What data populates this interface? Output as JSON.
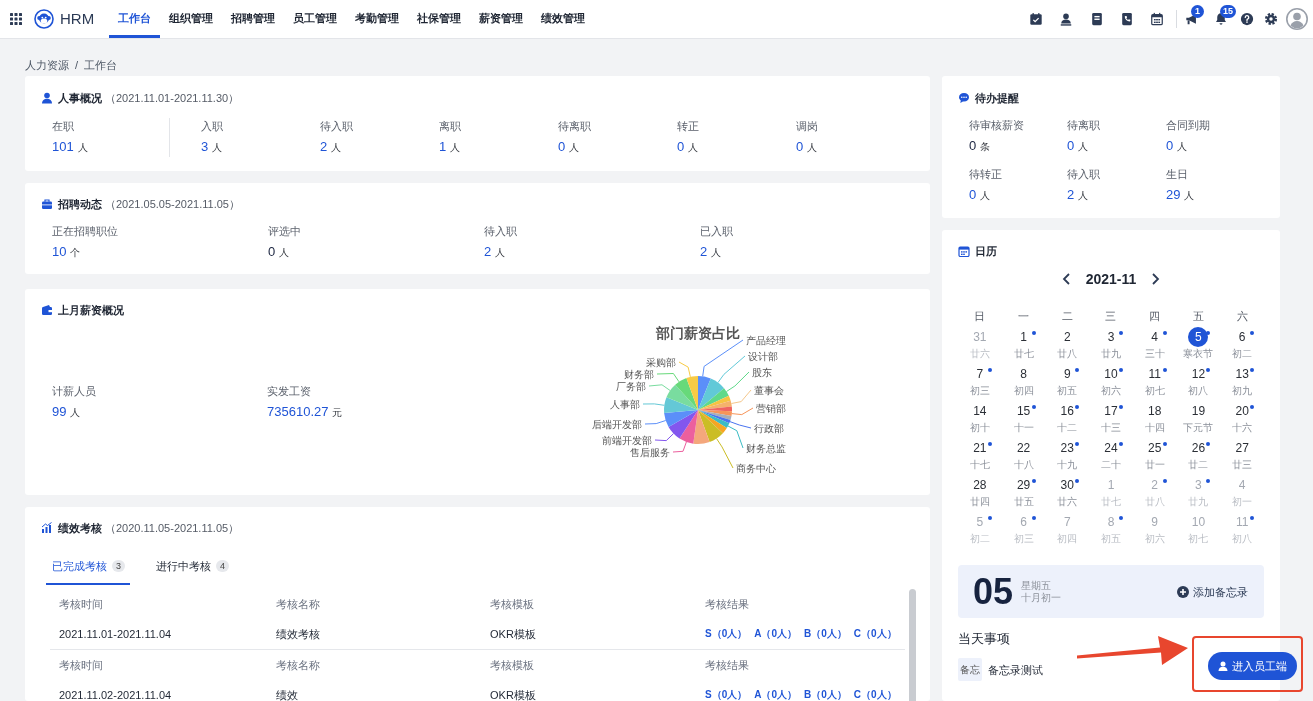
{
  "nav": {
    "brand": "HRM",
    "items": [
      {
        "label": "工作台",
        "selected": true
      },
      {
        "label": "组织管理",
        "selected": false
      },
      {
        "label": "招聘管理",
        "selected": false
      },
      {
        "label": "员工管理",
        "selected": false
      },
      {
        "label": "考勤管理",
        "selected": false
      },
      {
        "label": "社保管理",
        "selected": false
      },
      {
        "label": "薪资管理",
        "selected": false
      },
      {
        "label": "绩效管理",
        "selected": false
      }
    ],
    "flag_badge": "1",
    "bell_badge": "15"
  },
  "breadcrumb": {
    "items": [
      "人力资源",
      "工作台"
    ],
    "separator": "/"
  },
  "hr_overview": {
    "title": "人事概况",
    "range": "（2021.11.01-2021.11.30）",
    "stats": [
      {
        "label": "在职",
        "value": "101",
        "unit": "人"
      },
      {
        "label": "入职",
        "value": "3",
        "unit": "人"
      },
      {
        "label": "待入职",
        "value": "2",
        "unit": "人"
      },
      {
        "label": "离职",
        "value": "1",
        "unit": "人"
      },
      {
        "label": "待离职",
        "value": "0",
        "unit": "人"
      },
      {
        "label": "转正",
        "value": "0",
        "unit": "人"
      },
      {
        "label": "调岗",
        "value": "0",
        "unit": "人"
      }
    ]
  },
  "recruitment": {
    "title": "招聘动态",
    "range": "（2021.05.05-2021.11.05）",
    "stats": [
      {
        "label": "正在招聘职位",
        "value": "10",
        "unit": "个",
        "kind": "link"
      },
      {
        "label": "评选中",
        "value": "0",
        "unit": "人",
        "kind": "plain"
      },
      {
        "label": "待入职",
        "value": "2",
        "unit": "人",
        "kind": "link"
      },
      {
        "label": "已入职",
        "value": "2",
        "unit": "人",
        "kind": "link"
      }
    ]
  },
  "salary": {
    "title": "上月薪资概况",
    "stats": [
      {
        "label": "计薪人员",
        "value": "99",
        "unit": "人"
      },
      {
        "label": "实发工资",
        "value": "735610.27",
        "unit": "元"
      }
    ],
    "chart": {
      "title": "部门薪资占比",
      "labels": [
        "产品经理",
        "设计部",
        "采购部",
        "股东",
        "财务部",
        "厂务部",
        "董事会",
        "人事部",
        "营销部",
        "后端开发部",
        "行政部",
        "前端开发部",
        "财务总监",
        "售后服务",
        "商务中心"
      ]
    }
  },
  "performance": {
    "title": "绩效考核",
    "range": "（2020.11.05-2021.11.05）",
    "tabs": [
      {
        "label": "已完成考核",
        "count": "3",
        "selected": true
      },
      {
        "label": "进行中考核",
        "count": "4",
        "selected": false
      }
    ],
    "records": [
      {
        "headers": [
          "考核时间",
          "考核名称",
          "考核模板",
          "考核结果"
        ],
        "cells": [
          "2021.11.01-2021.11.04",
          "绩效考核",
          "OKR模板"
        ],
        "results": [
          "S（0人）",
          "A（0人）",
          "B（0人）",
          "C（0人）"
        ]
      },
      {
        "headers": [
          "考核时间",
          "考核名称",
          "考核模板",
          "考核结果"
        ],
        "cells": [
          "2021.11.02-2021.11.04",
          "绩效",
          "OKR模板"
        ],
        "results": [
          "S（0人）",
          "A（0人）",
          "B（0人）",
          "C（0人）"
        ]
      }
    ]
  },
  "todo": {
    "title": "待办提醒",
    "items": [
      {
        "label": "待审核薪资",
        "value": "0",
        "unit": "条",
        "kind": "plain"
      },
      {
        "label": "待离职",
        "value": "0",
        "unit": "人",
        "kind": "link"
      },
      {
        "label": "合同到期",
        "value": "0",
        "unit": "人",
        "kind": "link"
      },
      {
        "label": "待转正",
        "value": "0",
        "unit": "人",
        "kind": "link"
      },
      {
        "label": "待入职",
        "value": "2",
        "unit": "人",
        "kind": "link"
      },
      {
        "label": "生日",
        "value": "29",
        "unit": "人",
        "kind": "link"
      }
    ]
  },
  "calendar": {
    "title": "日历",
    "month": "2021-11",
    "weekdays": [
      "日",
      "一",
      "二",
      "三",
      "四",
      "五",
      "六"
    ],
    "weeks": [
      [
        {
          "day": "31",
          "lunar": "廿六",
          "other_month": true,
          "dot": false,
          "selected": false
        },
        {
          "day": "1",
          "lunar": "廿七",
          "other_month": false,
          "dot": true,
          "selected": false
        },
        {
          "day": "2",
          "lunar": "廿八",
          "other_month": false,
          "dot": false,
          "selected": false
        },
        {
          "day": "3",
          "lunar": "廿九",
          "other_month": false,
          "dot": true,
          "selected": false
        },
        {
          "day": "4",
          "lunar": "三十",
          "other_month": false,
          "dot": true,
          "selected": false
        },
        {
          "day": "5",
          "lunar": "寒衣节",
          "other_month": false,
          "dot": true,
          "selected": true
        },
        {
          "day": "6",
          "lunar": "初二",
          "other_month": false,
          "dot": true,
          "selected": false
        }
      ],
      [
        {
          "day": "7",
          "lunar": "初三",
          "other_month": false,
          "dot": true,
          "selected": false
        },
        {
          "day": "8",
          "lunar": "初四",
          "other_month": false,
          "dot": false,
          "selected": false
        },
        {
          "day": "9",
          "lunar": "初五",
          "other_month": false,
          "dot": true,
          "selected": false
        },
        {
          "day": "10",
          "lunar": "初六",
          "other_month": false,
          "dot": true,
          "selected": false
        },
        {
          "day": "11",
          "lunar": "初七",
          "other_month": false,
          "dot": true,
          "selected": false
        },
        {
          "day": "12",
          "lunar": "初八",
          "other_month": false,
          "dot": true,
          "selected": false
        },
        {
          "day": "13",
          "lunar": "初九",
          "other_month": false,
          "dot": true,
          "selected": false
        }
      ],
      [
        {
          "day": "14",
          "lunar": "初十",
          "other_month": false,
          "dot": false,
          "selected": false
        },
        {
          "day": "15",
          "lunar": "十一",
          "other_month": false,
          "dot": true,
          "selected": false
        },
        {
          "day": "16",
          "lunar": "十二",
          "other_month": false,
          "dot": true,
          "selected": false
        },
        {
          "day": "17",
          "lunar": "十三",
          "other_month": false,
          "dot": true,
          "selected": false
        },
        {
          "day": "18",
          "lunar": "十四",
          "other_month": false,
          "dot": false,
          "selected": false
        },
        {
          "day": "19",
          "lunar": "下元节",
          "other_month": false,
          "dot": false,
          "selected": false
        },
        {
          "day": "20",
          "lunar": "十六",
          "other_month": false,
          "dot": true,
          "selected": false
        }
      ],
      [
        {
          "day": "21",
          "lunar": "十七",
          "other_month": false,
          "dot": true,
          "selected": false
        },
        {
          "day": "22",
          "lunar": "十八",
          "other_month": false,
          "dot": false,
          "selected": false
        },
        {
          "day": "23",
          "lunar": "十九",
          "other_month": false,
          "dot": true,
          "selected": false
        },
        {
          "day": "24",
          "lunar": "二十",
          "other_month": false,
          "dot": true,
          "selected": false
        },
        {
          "day": "25",
          "lunar": "廿一",
          "other_month": false,
          "dot": true,
          "selected": false
        },
        {
          "day": "26",
          "lunar": "廿二",
          "other_month": false,
          "dot": true,
          "selected": false
        },
        {
          "day": "27",
          "lunar": "廿三",
          "other_month": false,
          "dot": false,
          "selected": false
        }
      ],
      [
        {
          "day": "28",
          "lunar": "廿四",
          "other_month": false,
          "dot": false,
          "selected": false
        },
        {
          "day": "29",
          "lunar": "廿五",
          "other_month": false,
          "dot": true,
          "selected": false
        },
        {
          "day": "30",
          "lunar": "廿六",
          "other_month": false,
          "dot": true,
          "selected": false
        },
        {
          "day": "1",
          "lunar": "廿七",
          "other_month": true,
          "dot": false,
          "selected": false
        },
        {
          "day": "2",
          "lunar": "廿八",
          "other_month": true,
          "dot": true,
          "selected": false
        },
        {
          "day": "3",
          "lunar": "廿九",
          "other_month": true,
          "dot": true,
          "selected": false
        },
        {
          "day": "4",
          "lunar": "初一",
          "other_month": true,
          "dot": false,
          "selected": false
        }
      ],
      [
        {
          "day": "5",
          "lunar": "初二",
          "other_month": true,
          "dot": true,
          "selected": false
        },
        {
          "day": "6",
          "lunar": "初三",
          "other_month": true,
          "dot": true,
          "selected": false
        },
        {
          "day": "7",
          "lunar": "初四",
          "other_month": true,
          "dot": false,
          "selected": false
        },
        {
          "day": "8",
          "lunar": "初五",
          "other_month": true,
          "dot": true,
          "selected": false
        },
        {
          "day": "9",
          "lunar": "初六",
          "other_month": true,
          "dot": false,
          "selected": false
        },
        {
          "day": "10",
          "lunar": "初七",
          "other_month": true,
          "dot": false,
          "selected": false
        },
        {
          "day": "11",
          "lunar": "初八",
          "other_month": true,
          "dot": true,
          "selected": false
        }
      ]
    ]
  },
  "memo": {
    "day": "05",
    "weekday": "星期五",
    "lunar": "十月初一",
    "add_label": "添加备忘录"
  },
  "today": {
    "title": "当天事项",
    "items": [
      {
        "tag": "备忘",
        "text": "备忘录测试"
      }
    ]
  },
  "portal_button": "进入员工端"
}
